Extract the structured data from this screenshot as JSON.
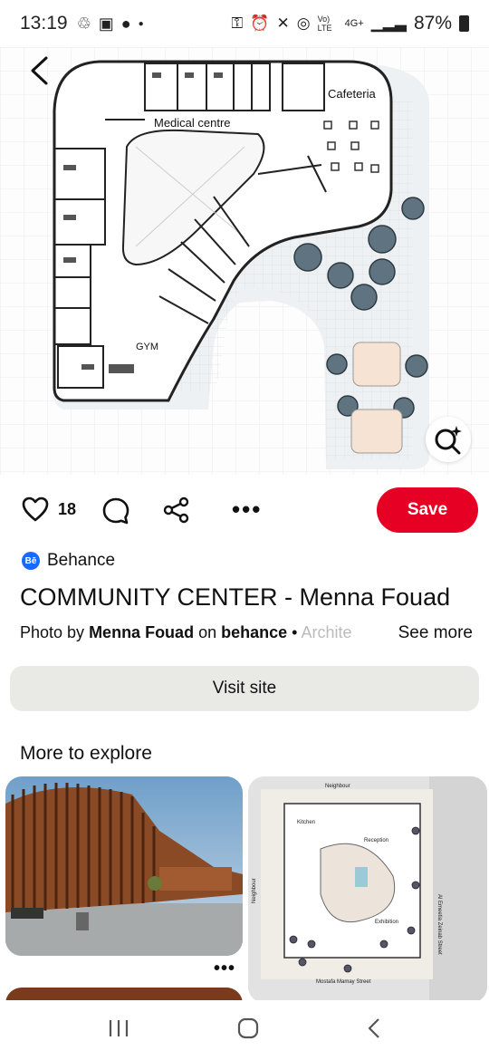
{
  "status_bar": {
    "time": "13:19",
    "network": "4G+",
    "volte": "Vo) LTE",
    "battery": "87%"
  },
  "pin": {
    "plan_labels": {
      "medical": "Medical centre",
      "cafeteria": "Cafeteria",
      "gym": "GYM"
    },
    "like_count": "18",
    "save_label": "Save",
    "source": "Behance",
    "source_badge": "Bē",
    "title": "COMMUNITY CENTER - Menna Fouad",
    "desc_prefix": "Photo by ",
    "desc_author": "Menna Fouad",
    "desc_on": " on ",
    "desc_site": "behance",
    "desc_sep": " • ",
    "desc_tail": "Archite",
    "see_more": "See more",
    "visit_label": "Visit site"
  },
  "explore": {
    "heading": "More to explore",
    "card2_labels": {
      "neighbour_top": "Neighbour",
      "kitchen": "Kitchen",
      "reception": "Reception",
      "exhibition": "Exhibition",
      "street_right": "Al Emeetia Zeinab Street",
      "street_bottom": "Mostafa Mamay Street",
      "neighbour_left": "Neighbour"
    }
  },
  "colors": {
    "save": "#e60023",
    "visit_bg": "#e9e9e6",
    "behance": "#1769ff"
  },
  "icons": [
    "back-arrow-icon",
    "heart-icon",
    "comment-icon",
    "share-icon",
    "more-dots-icon",
    "visual-search-icon",
    "recents-icon",
    "home-icon",
    "nav-back-icon"
  ]
}
